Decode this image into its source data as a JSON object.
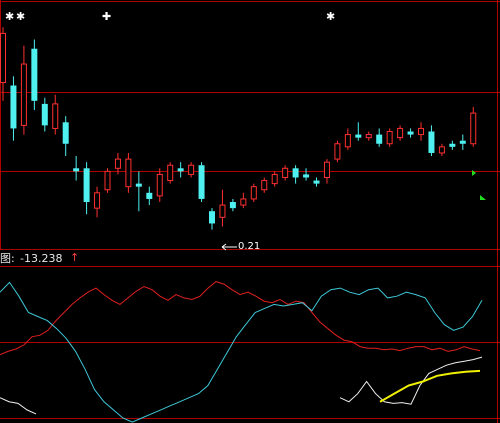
{
  "markers": {
    "star": "✱",
    "plus": "✚"
  },
  "indicator": {
    "prefix": "图:",
    "value": "-13.238",
    "arrow": "↑"
  },
  "low_label": {
    "text": "0.21"
  },
  "colors": {
    "background": "#000000",
    "grid_red": "#b00000",
    "bull_candle": "#ff3030",
    "bear_candle": "#4ff0f0",
    "line_red": "#e02020",
    "line_cyan": "#3fc8d8",
    "line_white": "#f0f0f0",
    "line_yellow": "#f0f000",
    "signal_green": "#20e020"
  },
  "chart_data": [
    {
      "type": "candlestick",
      "title": "",
      "grid": true,
      "candles": [
        {
          "dir": "bull",
          "o": 154,
          "c": 170,
          "h": 172,
          "l": 148
        },
        {
          "dir": "bear",
          "o": 153,
          "c": 139,
          "h": 156,
          "l": 135
        },
        {
          "dir": "bull",
          "o": 140,
          "c": 160,
          "h": 166,
          "l": 137
        },
        {
          "dir": "bear",
          "o": 165,
          "c": 148,
          "h": 168,
          "l": 145
        },
        {
          "dir": "bear",
          "o": 147,
          "c": 140,
          "h": 149,
          "l": 138
        },
        {
          "dir": "bull",
          "o": 139,
          "c": 147,
          "h": 150,
          "l": 137
        },
        {
          "dir": "bear",
          "o": 141,
          "c": 134,
          "h": 143,
          "l": 130
        },
        {
          "dir": "bear",
          "o": 126,
          "c": 125,
          "h": 130,
          "l": 122
        },
        {
          "dir": "bear",
          "o": 126,
          "c": 115,
          "h": 128,
          "l": 111
        },
        {
          "dir": "bull",
          "o": 113,
          "c": 118,
          "h": 120,
          "l": 110
        },
        {
          "dir": "bull",
          "o": 119,
          "c": 125,
          "h": 126,
          "l": 118
        },
        {
          "dir": "bull",
          "o": 126,
          "c": 129,
          "h": 131,
          "l": 124
        },
        {
          "dir": "bull",
          "o": 120,
          "c": 129,
          "h": 131,
          "l": 118
        },
        {
          "dir": "bear",
          "o": 121,
          "c": 120,
          "h": 125,
          "l": 112
        },
        {
          "dir": "bear",
          "o": 118,
          "c": 116,
          "h": 120,
          "l": 114
        },
        {
          "dir": "bull",
          "o": 117,
          "c": 124,
          "h": 126,
          "l": 115
        },
        {
          "dir": "bull",
          "o": 122,
          "c": 127,
          "h": 128,
          "l": 121
        },
        {
          "dir": "bear",
          "o": 126,
          "c": 125,
          "h": 128,
          "l": 123
        },
        {
          "dir": "bull",
          "o": 124,
          "c": 127,
          "h": 128,
          "l": 123
        },
        {
          "dir": "bear",
          "o": 127,
          "c": 116,
          "h": 128,
          "l": 115
        },
        {
          "dir": "bear",
          "o": 112,
          "c": 108,
          "h": 113,
          "l": 106
        },
        {
          "dir": "bull",
          "o": 110,
          "c": 114,
          "h": 119,
          "l": 107
        },
        {
          "dir": "bear",
          "o": 115,
          "c": 113,
          "h": 116,
          "l": 112
        },
        {
          "dir": "bull",
          "o": 114,
          "c": 116,
          "h": 118,
          "l": 113
        },
        {
          "dir": "bull",
          "o": 116,
          "c": 120,
          "h": 121,
          "l": 115
        },
        {
          "dir": "bull",
          "o": 119,
          "c": 122,
          "h": 123,
          "l": 118
        },
        {
          "dir": "bull",
          "o": 121,
          "c": 124,
          "h": 125,
          "l": 120
        },
        {
          "dir": "bull",
          "o": 123,
          "c": 126,
          "h": 127,
          "l": 122
        },
        {
          "dir": "bear",
          "o": 126,
          "c": 123,
          "h": 127,
          "l": 121
        },
        {
          "dir": "bear",
          "o": 124,
          "c": 123,
          "h": 126,
          "l": 122
        },
        {
          "dir": "bear",
          "o": 122,
          "c": 121,
          "h": 123,
          "l": 120
        },
        {
          "dir": "bull",
          "o": 123,
          "c": 128,
          "h": 129,
          "l": 121
        },
        {
          "dir": "bull",
          "o": 129,
          "c": 134,
          "h": 135,
          "l": 128
        },
        {
          "dir": "bull",
          "o": 133,
          "c": 137,
          "h": 139,
          "l": 132
        },
        {
          "dir": "bear",
          "o": 137,
          "c": 136,
          "h": 141,
          "l": 135
        },
        {
          "dir": "bull",
          "o": 136,
          "c": 137,
          "h": 138,
          "l": 135
        },
        {
          "dir": "bear",
          "o": 137,
          "c": 134,
          "h": 139,
          "l": 133
        },
        {
          "dir": "bull",
          "o": 134,
          "c": 138,
          "h": 139,
          "l": 133
        },
        {
          "dir": "bull",
          "o": 136,
          "c": 139,
          "h": 140,
          "l": 135
        },
        {
          "dir": "bear",
          "o": 138,
          "c": 137,
          "h": 139,
          "l": 136
        },
        {
          "dir": "bull",
          "o": 137,
          "c": 139,
          "h": 141,
          "l": 135
        },
        {
          "dir": "bear",
          "o": 138,
          "c": 131,
          "h": 140,
          "l": 130
        },
        {
          "dir": "bull",
          "o": 131,
          "c": 133,
          "h": 134,
          "l": 130
        },
        {
          "dir": "bear",
          "o": 134,
          "c": 133,
          "h": 135,
          "l": 132
        },
        {
          "dir": "bear",
          "o": 135,
          "c": 134,
          "h": 137,
          "l": 132
        },
        {
          "dir": "bull",
          "o": 134,
          "c": 144,
          "h": 146,
          "l": 133
        }
      ]
    },
    {
      "type": "line",
      "title": "",
      "grid": true,
      "series": [
        {
          "color": "red",
          "values": [
            -92,
            -88,
            -85,
            -80,
            -70,
            -68,
            -62,
            -50,
            -40,
            -30,
            -22,
            -15,
            -10,
            -18,
            -25,
            -30,
            -22,
            -14,
            -8,
            -12,
            -20,
            -25,
            -18,
            -22,
            -24,
            -20,
            -10,
            -2,
            -5,
            -12,
            -18,
            -15,
            -20,
            -26,
            -28,
            -24,
            -30,
            -26,
            -28,
            -40,
            -52,
            -60,
            -68,
            -74,
            -76,
            -82,
            -84,
            -84,
            -86,
            -85,
            -87,
            -84,
            -82,
            -82,
            -86,
            -84,
            -88,
            -86,
            -82,
            -85,
            -87
          ]
        },
        {
          "color": "cyan",
          "values": [
            -15,
            -3,
            -20,
            -40,
            -45,
            -50,
            -60,
            -72,
            -88,
            -110,
            -135,
            -150,
            -160,
            -170,
            -175,
            -170,
            -165,
            -160,
            -155,
            -150,
            -145,
            -140,
            -130,
            -110,
            -90,
            -70,
            -55,
            -40,
            -35,
            -30,
            -32,
            -30,
            -28,
            -38,
            -20,
            -12,
            -10,
            -15,
            -18,
            -12,
            -10,
            -22,
            -20,
            -15,
            -18,
            -22,
            -40,
            -55,
            -62,
            -58,
            -45,
            -25
          ]
        },
        {
          "color": "white",
          "values": [
            -145,
            -150,
            -140,
            -125,
            -140,
            -150,
            -152,
            -151,
            -153,
            -130,
            -115,
            -110,
            -105,
            -102,
            -100,
            -98,
            -95
          ]
        },
        {
          "color": "yellow",
          "values": [
            -150,
            -140,
            -130,
            -125,
            -118,
            -115,
            -113,
            -112
          ]
        }
      ]
    }
  ]
}
